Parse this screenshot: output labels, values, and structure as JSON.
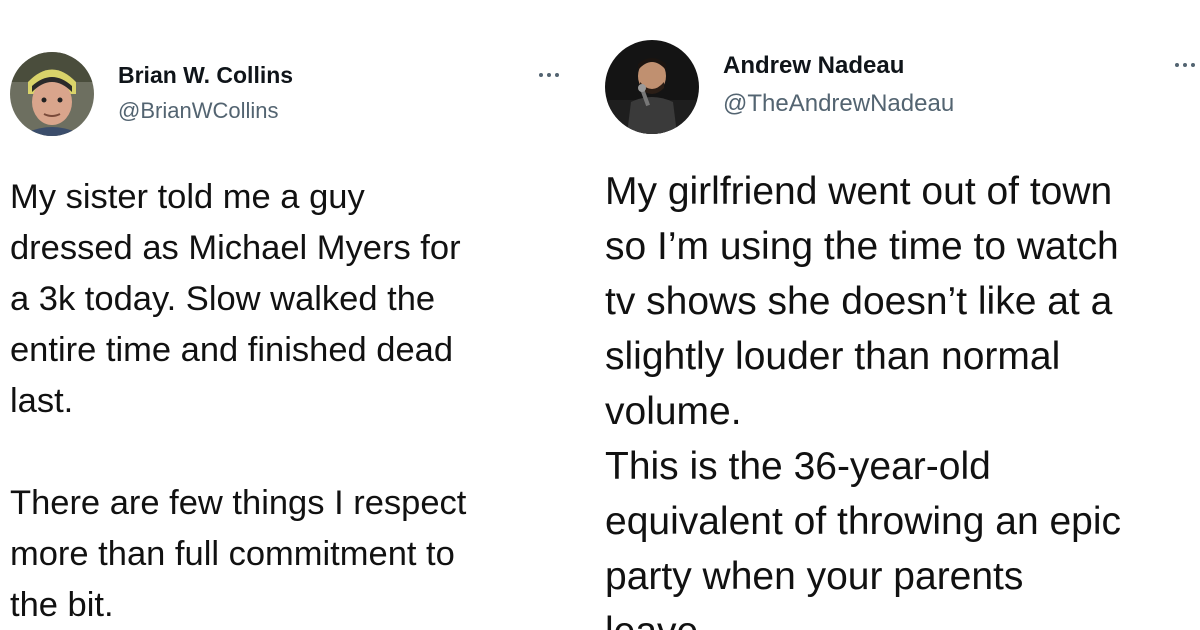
{
  "tweets": [
    {
      "author": {
        "name": "Brian W. Collins",
        "handle": "@BrianWCollins"
      },
      "more_icon": "more-horizontal-icon",
      "body_lines": [
        "My sister told me a guy",
        "dressed as Michael Myers for",
        "a 3k today. Slow walked the",
        "entire time and finished dead",
        "last.",
        "",
        "There are few things I respect",
        "more than full commitment to",
        "the bit."
      ]
    },
    {
      "author": {
        "name": "Andrew Nadeau",
        "handle": "@TheAndrewNadeau"
      },
      "more_icon": "more-horizontal-icon",
      "body_lines": [
        "My girlfriend went out of town",
        "so I’m using the time to watch",
        "tv shows she doesn’t like at a",
        "slightly louder than normal",
        "volume.",
        "This is the 36-year-old",
        "equivalent of throwing an epic",
        "party when your parents",
        "leave."
      ]
    }
  ]
}
